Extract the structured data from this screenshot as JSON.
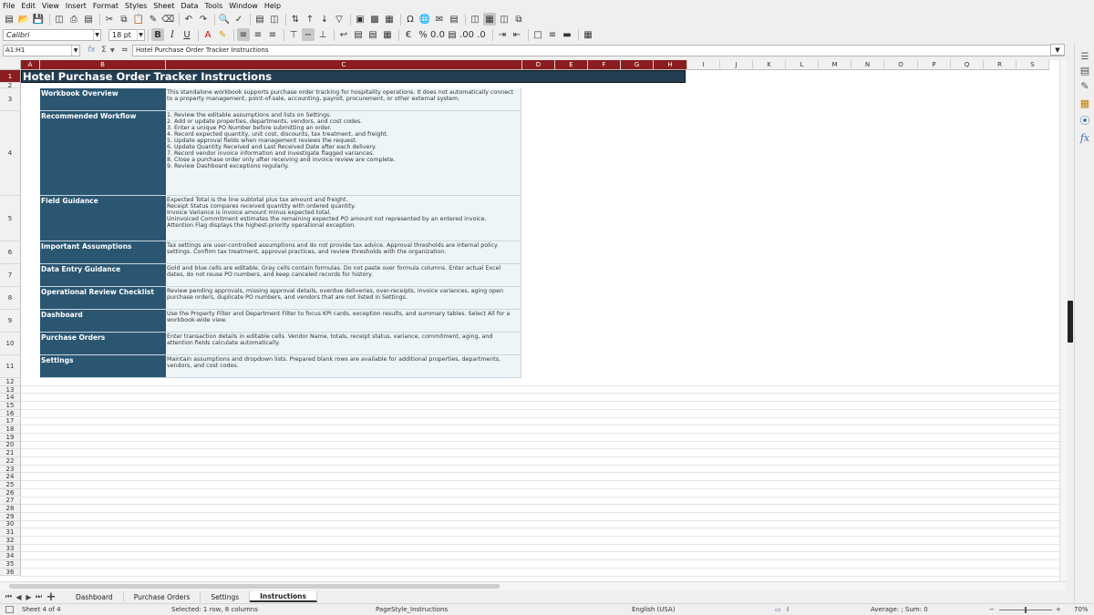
{
  "menu": [
    "File",
    "Edit",
    "View",
    "Insert",
    "Format",
    "Styles",
    "Sheet",
    "Data",
    "Tools",
    "Window",
    "Help"
  ],
  "font": {
    "name": "Calibri",
    "size": "18 pt"
  },
  "name_box": "A1:H1",
  "formula": "Hotel Purchase Order Tracker Instructions",
  "columns": [
    {
      "label": "A",
      "sel": true
    },
    {
      "label": "B",
      "sel": true
    },
    {
      "label": "C",
      "sel": true
    },
    {
      "label": "D",
      "sel": true
    },
    {
      "label": "E",
      "sel": true
    },
    {
      "label": "F",
      "sel": true
    },
    {
      "label": "G",
      "sel": true
    },
    {
      "label": "H",
      "sel": true
    },
    {
      "label": "I",
      "sel": false
    },
    {
      "label": "J",
      "sel": false
    },
    {
      "label": "K",
      "sel": false
    },
    {
      "label": "L",
      "sel": false
    },
    {
      "label": "M",
      "sel": false
    },
    {
      "label": "N",
      "sel": false
    },
    {
      "label": "O",
      "sel": false
    },
    {
      "label": "P",
      "sel": false
    },
    {
      "label": "Q",
      "sel": false
    },
    {
      "label": "R",
      "sel": false
    },
    {
      "label": "S",
      "sel": false
    }
  ],
  "sheet": {
    "title": "Hotel Purchase Order Tracker Instructions",
    "rows": [
      {
        "label": "Workbook Overview",
        "text": "This standalone workbook supports purchase order tracking for hospitality operations. It does not automatically connect to a property management, point-of-sale, accounting, payroll, procurement, or other external system."
      },
      {
        "label": "Recommended Workflow",
        "text": "1. Review the editable assumptions and lists on Settings.\n2. Add or update properties, departments, vendors, and cost codes.\n3. Enter a unique PO Number before submitting an order.\n4. Record expected quantity, unit cost, discounts, tax treatment, and freight.\n5. Update approval fields when management reviews the request.\n6. Update Quantity Received and Last Received Date after each delivery.\n7. Record vendor invoice information and investigate flagged variances.\n8. Close a purchase order only after receiving and invoice review are complete.\n9. Review Dashboard exceptions regularly."
      },
      {
        "label": "Field Guidance",
        "text": "Expected Total is the line subtotal plus tax amount and freight.\nReceipt Status compares received quantity with ordered quantity.\nInvoice Variance is invoice amount minus expected total.\nUninvoiced Commitment estimates the remaining expected PO amount not represented by an entered invoice.\nAttention Flag displays the highest-priority operational exception."
      },
      {
        "label": "Important Assumptions",
        "text": "Tax settings are user-controlled assumptions and do not provide tax advice. Approval thresholds are internal policy settings. Confirm tax treatment, approval practices, and review thresholds with the organization."
      },
      {
        "label": "Data Entry Guidance",
        "text": "Gold and blue cells are editable. Gray cells contain formulas. Do not paste over formula columns. Enter actual Excel dates, do not reuse PO numbers, and keep canceled records for history."
      },
      {
        "label": "Operational Review Checklist",
        "text": "Review pending approvals, missing approval details, overdue deliveries, over-receipts, invoice variances, aging open purchase orders, duplicate PO numbers, and vendors that are not listed in Settings."
      },
      {
        "label": "Dashboard",
        "text": "Use the Property Filter and Department Filter to focus KPI cards, exception results, and summary tables. Select All for a workbook-wide view."
      },
      {
        "label": "Purchase Orders",
        "text": "Enter transaction details in editable cells. Vendor Name, totals, receipt status, variance, commitment, aging, and attention fields calculate automatically."
      },
      {
        "label": "Settings",
        "text": "Maintain assumptions and dropdown lists. Prepared blank rows are available for additional properties, departments, vendors, and cost codes."
      }
    ]
  },
  "row_numbers": [
    "1",
    "2",
    "3",
    "4",
    "5",
    "6",
    "7",
    "8",
    "9",
    "10",
    "11",
    "12",
    "13",
    "14",
    "15",
    "16",
    "17",
    "18",
    "19",
    "20",
    "21",
    "22",
    "23",
    "24",
    "25",
    "26",
    "27",
    "28",
    "29",
    "30",
    "31",
    "32",
    "33",
    "34",
    "35",
    "36"
  ],
  "tabs": [
    {
      "label": "Dashboard",
      "active": false
    },
    {
      "label": "Purchase Orders",
      "active": false
    },
    {
      "label": "Settings",
      "active": false
    },
    {
      "label": "Instructions",
      "active": true
    }
  ],
  "status": {
    "sheet": "Sheet 4 of 4",
    "selection": "Selected: 1 row, 8 columns",
    "page_style": "PageStyle_Instructions",
    "language": "English (USA)",
    "summary": "Average: ; Sum: 0",
    "zoom": "70%"
  }
}
